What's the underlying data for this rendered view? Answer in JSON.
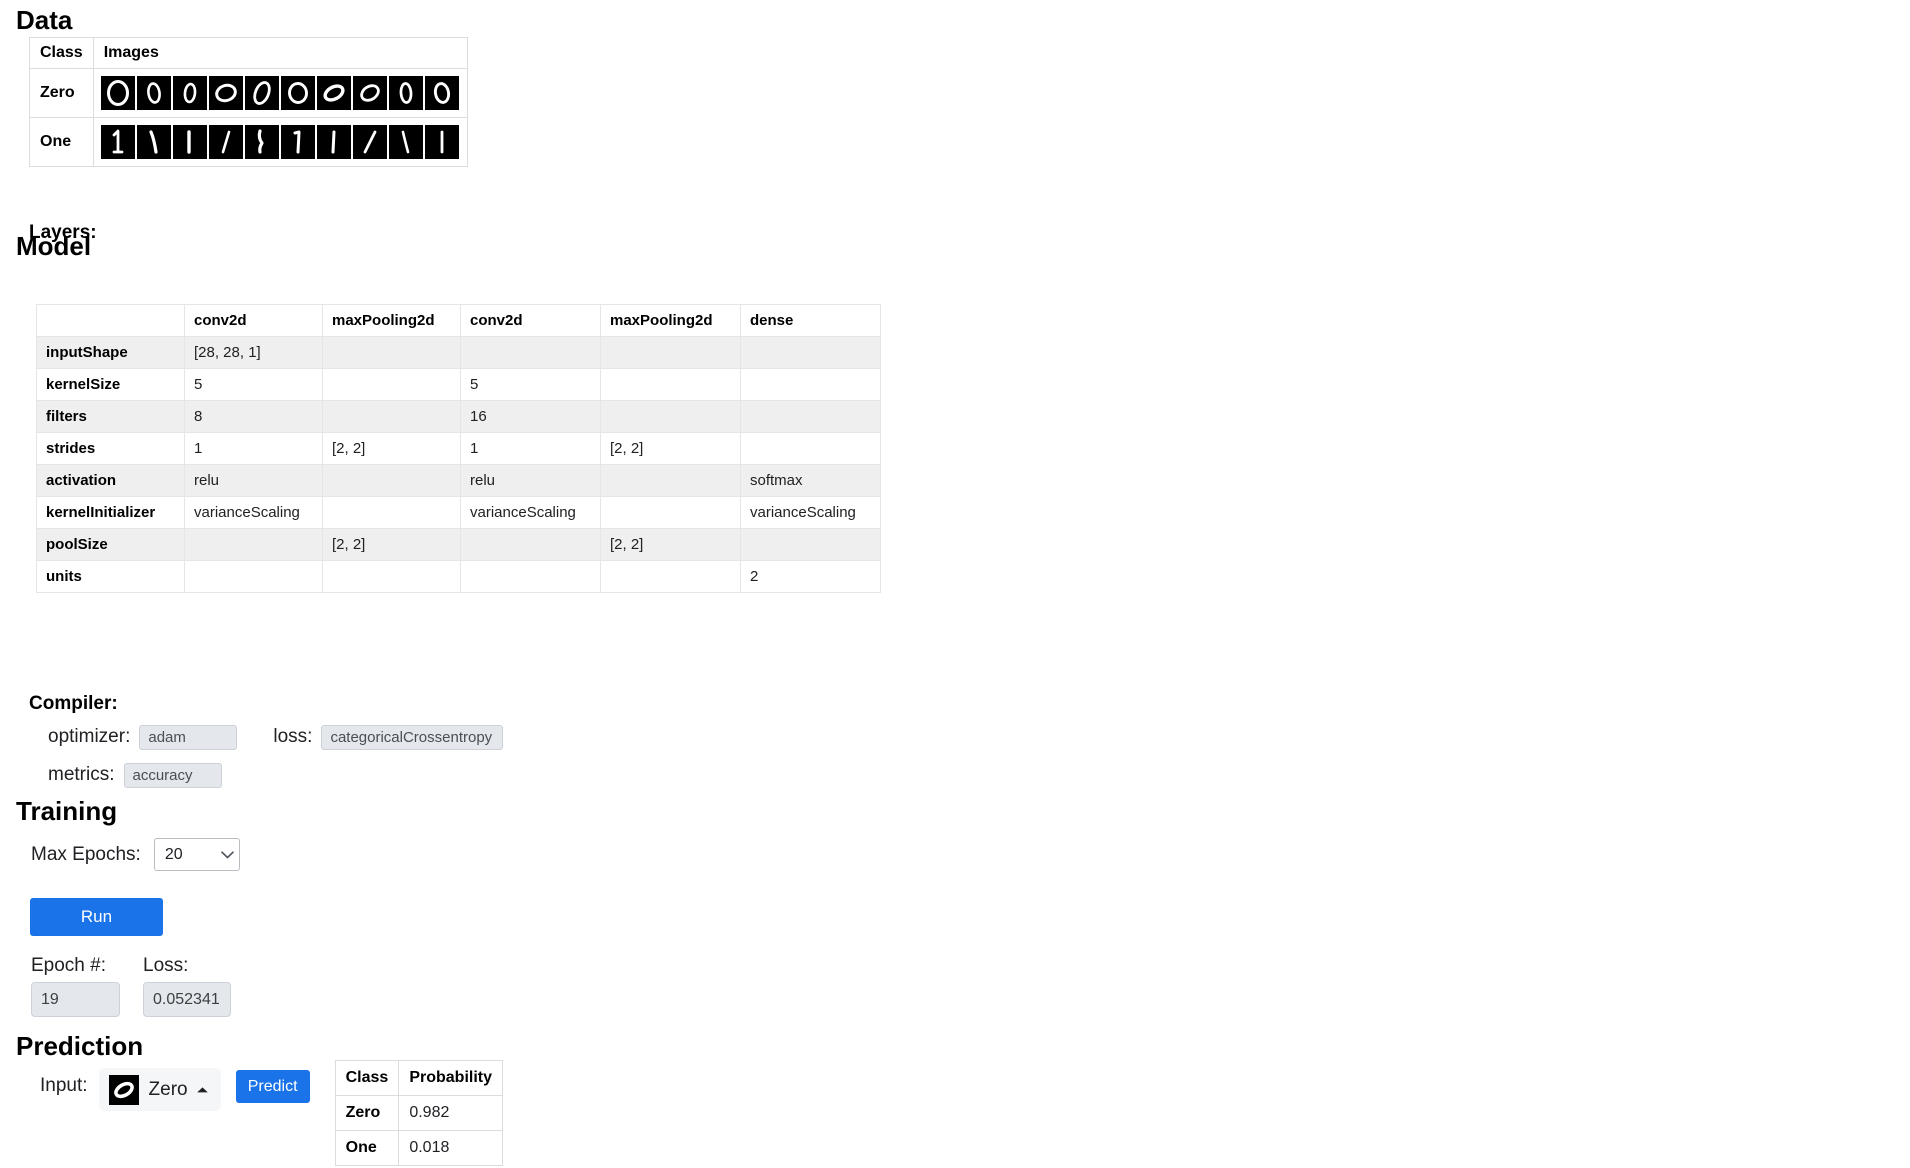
{
  "sections": {
    "data_title": "Data",
    "model_title": "Model",
    "training_title": "Training",
    "prediction_title": "Prediction"
  },
  "data_table": {
    "headers": [
      "Class",
      "Images"
    ],
    "rows": [
      {
        "class": "Zero",
        "count": 10
      },
      {
        "class": "One",
        "count": 10
      }
    ]
  },
  "model": {
    "layers_label": "Layers:",
    "columns": [
      "",
      "conv2d",
      "maxPooling2d",
      "conv2d",
      "maxPooling2d",
      "dense"
    ],
    "rows": [
      {
        "property": "inputShape",
        "values": [
          "[28, 28, 1]",
          "",
          "",
          "",
          ""
        ]
      },
      {
        "property": "kernelSize",
        "values": [
          "5",
          "",
          "5",
          "",
          ""
        ]
      },
      {
        "property": "filters",
        "values": [
          "8",
          "",
          "16",
          "",
          ""
        ]
      },
      {
        "property": "strides",
        "values": [
          "1",
          "[2, 2]",
          "1",
          "[2, 2]",
          ""
        ]
      },
      {
        "property": "activation",
        "values": [
          "relu",
          "",
          "relu",
          "",
          "softmax"
        ]
      },
      {
        "property": "kernelInitializer",
        "values": [
          "varianceScaling",
          "",
          "varianceScaling",
          "",
          "varianceScaling"
        ]
      },
      {
        "property": "poolSize",
        "values": [
          "",
          "[2, 2]",
          "",
          "[2, 2]",
          ""
        ]
      },
      {
        "property": "units",
        "values": [
          "",
          "",
          "",
          "",
          "2"
        ]
      }
    ]
  },
  "compiler": {
    "label": "Compiler:",
    "optimizer_label": "optimizer:",
    "optimizer_value": "adam",
    "loss_label": "loss:",
    "loss_value": "categoricalCrossentropy",
    "metrics_label": "metrics:",
    "metrics_value": "accuracy"
  },
  "training": {
    "max_epochs_label": "Max Epochs:",
    "max_epochs_value": "20",
    "max_epochs_options": [
      "20"
    ],
    "run_label": "Run",
    "epoch_label": "Epoch #:",
    "epoch_value": "19",
    "loss_label": "Loss:",
    "loss_value": "0.052341"
  },
  "prediction": {
    "input_label": "Input:",
    "selected_class": "Zero",
    "predict_label": "Predict",
    "table": {
      "headers": [
        "Class",
        "Probability"
      ],
      "rows": [
        {
          "class": "Zero",
          "probability": "0.982"
        },
        {
          "class": "One",
          "probability": "0.018"
        }
      ]
    }
  },
  "colors": {
    "accent": "#1a73e8",
    "field_bg": "#e4e7eb",
    "row_alt": "#efefef",
    "border": "#dadce0"
  }
}
